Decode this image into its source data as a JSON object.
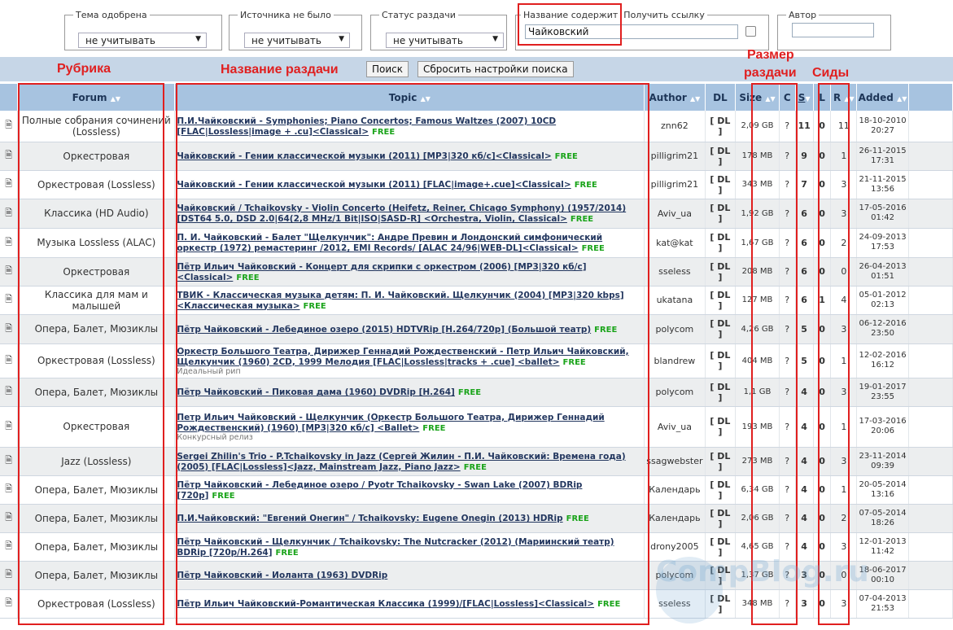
{
  "filters": {
    "approved": {
      "legend": "Тема одобрена",
      "value": "не учитывать"
    },
    "no_source": {
      "legend": "Источника не было",
      "value": "не учитывать"
    },
    "status": {
      "legend": "Статус раздачи",
      "value": "не учитывать"
    },
    "title_contains": {
      "legend": "Название содержит",
      "value": "Чайковский"
    },
    "get_link": {
      "legend": "Получить ссылку"
    },
    "author": {
      "legend": "Автор",
      "value": ""
    }
  },
  "buttons": {
    "search": "Поиск",
    "reset": "Сбросить настройки поиска"
  },
  "annotations": {
    "rubric": "Рубрика",
    "topic_name": "Название раздачи",
    "size_line1": "Размер",
    "size_line2": "раздачи",
    "seeds": "Сиды"
  },
  "columns": {
    "forum": "Forum",
    "topic": "Topic",
    "author": "Author",
    "dl": "DL",
    "size": "Size",
    "c": "C",
    "s": "S",
    "l": "L",
    "r": "R",
    "added": "Added"
  },
  "rows": [
    {
      "forum": "Полные собрания сочинений (Lossless)",
      "topic": "П.И.Чайковский - Symphonies; Piano Concertos; Famous Waltzes (2007) 10CD [FLAC|Lossless|image + .cu]<Classical>",
      "tag": "FREE",
      "note": "",
      "author": "znn62",
      "dl": "[ DL ]",
      "size": "2,09 GB",
      "c": "?",
      "s": "11",
      "l": "0",
      "r": "11",
      "date": "18-10-2010",
      "time": "20:27"
    },
    {
      "forum": "Оркестровая",
      "topic": "Чайковский - Гении классической музыки (2011) [MP3|320 кб/с]<Classical>",
      "tag": "FREE",
      "note": "",
      "author": "pilligrim21",
      "dl": "[ DL ]",
      "size": "178 MB",
      "c": "?",
      "s": "9",
      "l": "0",
      "r": "1",
      "date": "26-11-2015",
      "time": "17:31"
    },
    {
      "forum": "Оркестровая (Lossless)",
      "topic": "Чайковский - Гении классической музыки (2011) [FLAC|image+.cue]<Classical>",
      "tag": "FREE",
      "note": "",
      "author": "pilligrim21",
      "dl": "[ DL ]",
      "size": "343 MB",
      "c": "?",
      "s": "7",
      "l": "0",
      "r": "3",
      "date": "21-11-2015",
      "time": "13:56"
    },
    {
      "forum": "Классика (HD Audio)",
      "topic": "Чайковский / Tchaikovsky - Violin Concerto (Heifetz, Reiner, Chicago Symphony) (1957/2014) [DST64 5.0, DSD 2.0|64(2,8 MHz/1 Bit|ISO|SASD-R] <Orchestra, Violin, Classical>",
      "tag": "FREE",
      "note": "",
      "author": "Aviv_ua",
      "dl": "[ DL ]",
      "size": "1,92 GB",
      "c": "?",
      "s": "6",
      "l": "0",
      "r": "3",
      "date": "17-05-2016",
      "time": "01:42"
    },
    {
      "forum": "Музыка Lossless (ALAC)",
      "topic": "П. И. Чайковский - Балет \"Щелкунчик\": Андре Превин и Лондонский симфонический оркестр (1972) ремастеринг /2012, EMI Records/ [ALAC 24/96|WEB-DL]<Classical>",
      "tag": "FREE",
      "note": "",
      "author": "kat@kat",
      "dl": "[ DL ]",
      "size": "1,67 GB",
      "c": "?",
      "s": "6",
      "l": "0",
      "r": "2",
      "date": "24-09-2013",
      "time": "17:53"
    },
    {
      "forum": "Оркестровая",
      "topic": "Пётр Ильич Чайковский - Концерт для скрипки с оркестром (2006) [MP3|320 кб/с]<Classical>",
      "tag": "FREE",
      "note": "",
      "author": "sseless",
      "dl": "[ DL ]",
      "size": "208 MB",
      "c": "?",
      "s": "6",
      "l": "0",
      "r": "0",
      "date": "26-04-2013",
      "time": "01:51"
    },
    {
      "forum": "Классика для мам и малышей",
      "topic": "ТВИК - Классическая музыка детям: П. И. Чайковский. Щелкунчик (2004) [MP3|320 kbps] <Классическая музыка>",
      "tag": "FREE",
      "note": "",
      "author": "ukatana",
      "dl": "[ DL ]",
      "size": "127 MB",
      "c": "?",
      "s": "6",
      "l": "1",
      "r": "4",
      "date": "05-01-2012",
      "time": "02:13"
    },
    {
      "forum": "Опера, Балет, Мюзиклы",
      "topic": "Пётр Чайковский - Лебединое озеро (2015) HDTVRip [H.264/720p] (Большой театр)",
      "tag": "FREE",
      "note": "",
      "author": "polycom",
      "dl": "[ DL ]",
      "size": "4,26 GB",
      "c": "?",
      "s": "5",
      "l": "0",
      "r": "3",
      "date": "06-12-2016",
      "time": "23:50"
    },
    {
      "forum": "Оркестровая (Lossless)",
      "topic": "Оркестр Большого Театра, Дирижер Геннадий Рождественский - Петр Ильич Чайковский, Щелкунчик (1960) 2CD, 1999 Мелодия [FLAC|Lossless|tracks + .cue] <ballet>",
      "tag": "FREE",
      "note": "Идеальный рип",
      "author": "blandrew",
      "dl": "[ DL ]",
      "size": "404 MB",
      "c": "?",
      "s": "5",
      "l": "0",
      "r": "1",
      "date": "12-02-2016",
      "time": "16:12"
    },
    {
      "forum": "Опера, Балет, Мюзиклы",
      "topic": "Пётр Чайковский - Пиковая дама (1960) DVDRip [H.264]",
      "tag": "FREE",
      "note": "",
      "author": "polycom",
      "dl": "[ DL ]",
      "size": "1,1 GB",
      "c": "?",
      "s": "4",
      "l": "0",
      "r": "3",
      "date": "19-01-2017",
      "time": "23:55"
    },
    {
      "forum": "Оркестровая",
      "topic": "Петр Ильич Чайковский - Щелкунчик (Оркестр Большого Театра, Дирижер Геннадий Рождественский) (1960) [MP3|320 кб/с] <Ballet>",
      "tag": "FREE",
      "note": "Конкурсный релиз",
      "author": "Aviv_ua",
      "dl": "[ DL ]",
      "size": "193 MB",
      "c": "?",
      "s": "4",
      "l": "0",
      "r": "1",
      "date": "17-03-2016",
      "time": "20:06"
    },
    {
      "forum": "Jazz (Lossless)",
      "topic": "Sergei Zhilin's Trio - P.Tchaikovsky in Jazz (Сергей Жилин - П.И. Чайковский: Времена года) (2005) [FLAC|Lossless]<Jazz, Mainstream Jazz, Piano Jazz>",
      "tag": "FREE",
      "note": "",
      "author": "ssagwebster",
      "dl": "[ DL ]",
      "size": "273 MB",
      "c": "?",
      "s": "4",
      "l": "0",
      "r": "3",
      "date": "23-11-2014",
      "time": "09:39"
    },
    {
      "forum": "Опера, Балет, Мюзиклы",
      "topic": "Пётр Чайковский - Лебединое озеро / Pyotr Tchaikovsky - Swan Lake (2007) BDRip [720p]",
      "tag": "FREE",
      "note": "",
      "author": "Календарь",
      "dl": "[ DL ]",
      "size": "6,34 GB",
      "c": "?",
      "s": "4",
      "l": "0",
      "r": "1",
      "date": "20-05-2014",
      "time": "13:16"
    },
    {
      "forum": "Опера, Балет, Мюзиклы",
      "topic": "П.И.Чайковский: \"Евгений Онегин\" / Tchaikovsky: Eugene Onegin (2013) HDRip",
      "tag": "FREE",
      "note": "",
      "author": "Календарь",
      "dl": "[ DL ]",
      "size": "2,06 GB",
      "c": "?",
      "s": "4",
      "l": "0",
      "r": "2",
      "date": "07-05-2014",
      "time": "18:26"
    },
    {
      "forum": "Опера, Балет, Мюзиклы",
      "topic": "Пётр Чайковский - Щелкунчик / Tchaikovsky: The Nutcracker (2012) (Мариинский театр) BDRip [720p/H.264]",
      "tag": "FREE",
      "note": "",
      "author": "drony2005",
      "dl": "[ DL ]",
      "size": "4,65 GB",
      "c": "?",
      "s": "4",
      "l": "0",
      "r": "3",
      "date": "12-01-2013",
      "time": "11:42"
    },
    {
      "forum": "Опера, Балет, Мюзиклы",
      "topic": "Пётр Чайковский - Иоланта (1963) DVDRip",
      "tag": "",
      "note": "",
      "author": "polycom",
      "dl": "[ DL ]",
      "size": "1,37 GB",
      "c": "?",
      "s": "3",
      "l": "0",
      "r": "0",
      "date": "18-06-2017",
      "time": "00:10"
    },
    {
      "forum": "Оркестровая (Lossless)",
      "topic": "Пётр Ильич Чайковский-Романтическая Классика (1999)/[FLAC|Lossless]<Classical>",
      "tag": "FREE",
      "note": "",
      "author": "sseless",
      "dl": "[ DL ]",
      "size": "348 MB",
      "c": "?",
      "s": "3",
      "l": "0",
      "r": "3",
      "date": "07-04-2013",
      "time": "21:53"
    }
  ],
  "watermark": "CompBlog.ru",
  "colors": {
    "annotation": "#e01f1f",
    "header": "#a7c3e0",
    "seeds": "#0a7d0a",
    "leech": "#bb0000",
    "free": "#1aa41a"
  }
}
